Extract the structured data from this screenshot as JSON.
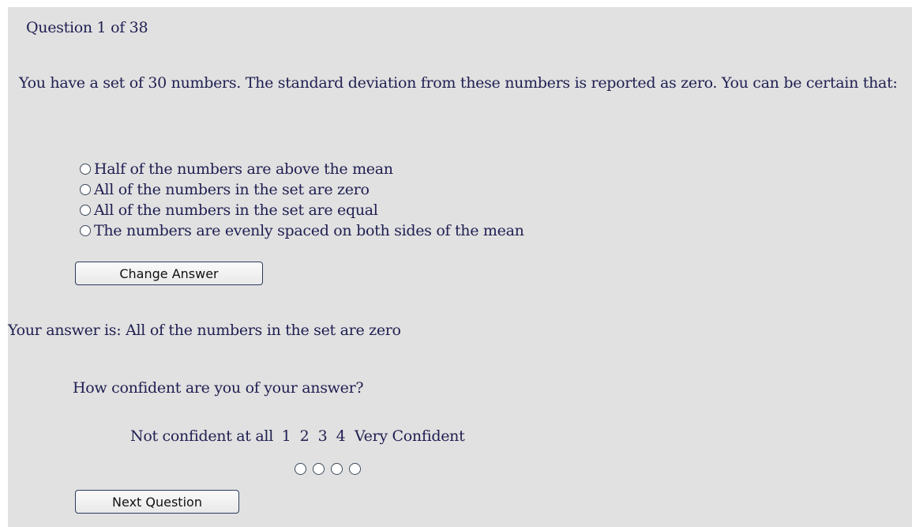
{
  "question": {
    "counter": "Question 1 of 38",
    "text": "You have a set of 30 numbers. The standard deviation from these numbers is reported as zero. You can be certain that:",
    "options": [
      {
        "label": "Half of the numbers are above the mean"
      },
      {
        "label": "All of the numbers in the set are zero"
      },
      {
        "label": "All of the numbers in the set are equal"
      },
      {
        "label": "The numbers are evenly spaced on both sides of the mean"
      }
    ],
    "change_button_label": "Change Answer"
  },
  "answer": {
    "text": "Your answer is: All of the numbers in the set are zero"
  },
  "confidence": {
    "prompt": "How confident are you of your answer?",
    "low_label": "Not confident at all",
    "high_label": "Very Confident",
    "levels": [
      "1",
      "2",
      "3",
      "4"
    ]
  },
  "next_button_label": "Next Question"
}
